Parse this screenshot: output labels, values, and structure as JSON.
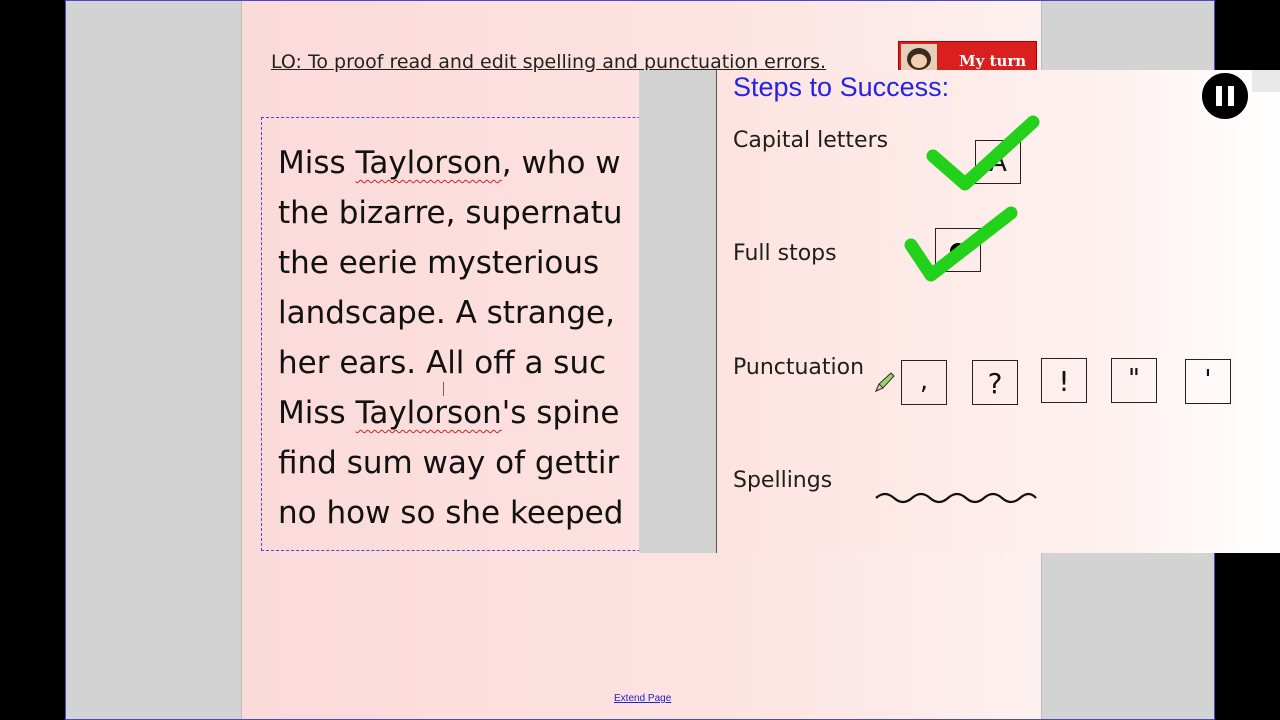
{
  "page": {
    "lo_text": "LO: To proof read and edit spelling and punctuation errors.",
    "my_turn_label": "My turn",
    "extend_link": "Extend Page"
  },
  "passage": {
    "lines": [
      [
        "Miss ",
        "Taylorson",
        ", who w"
      ],
      [
        "the bizarre, supernatu",
        "",
        ""
      ],
      [
        "the eerie mysterious ",
        "",
        ""
      ],
      [
        "landscape. A strange, ",
        "",
        ""
      ],
      [
        "her ears. All off a suc",
        "",
        ""
      ],
      [
        "Miss ",
        "Taylorson",
        "'s spine"
      ],
      [
        "find sum way of gettir",
        "",
        ""
      ],
      [
        "no how so she keeped ",
        "",
        ""
      ]
    ]
  },
  "steps": {
    "title": "Steps to Success:",
    "capital_label": "Capital letters",
    "capital_box": "A",
    "fullstop_label": "Full stops",
    "punct_label": "Punctuation",
    "punct_boxes": [
      ",",
      "?",
      "!",
      "\"",
      "'"
    ],
    "spell_label": "Spellings"
  },
  "colors": {
    "tick_green": "#22d11a",
    "title_blue": "#2323e6",
    "spell_underline": "#d02020"
  },
  "icons": [
    "pause-icon",
    "check-icon",
    "pencil-icon",
    "wavy-line-icon"
  ]
}
